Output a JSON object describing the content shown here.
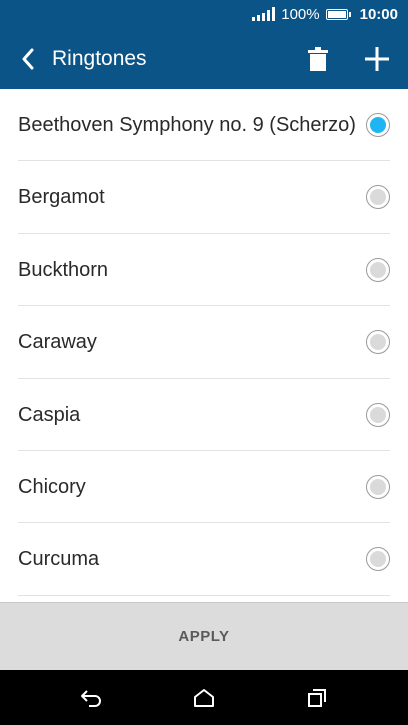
{
  "status_bar": {
    "battery_percent": "100%",
    "time": "10:00",
    "signal_icon": "signal-icon",
    "battery_icon": "battery-icon"
  },
  "app_bar": {
    "title": "Ringtones",
    "back_icon": "chevron-left-icon",
    "delete_icon": "trash-icon",
    "add_icon": "plus-icon",
    "background_color": "#0b5487"
  },
  "ringtones": [
    {
      "label": "Beethoven Symphony no. 9 (Scherzo)",
      "selected": true
    },
    {
      "label": "Bergamot",
      "selected": false
    },
    {
      "label": "Buckthorn",
      "selected": false
    },
    {
      "label": "Caraway",
      "selected": false
    },
    {
      "label": "Caspia",
      "selected": false
    },
    {
      "label": "Chicory",
      "selected": false
    },
    {
      "label": "Curcuma",
      "selected": false
    }
  ],
  "selected_color": "#1fb4f2",
  "apply_label": "APPLY",
  "nav_bar": {
    "back_icon": "back-arrow-icon",
    "home_icon": "home-icon",
    "recents_icon": "recents-icon"
  }
}
